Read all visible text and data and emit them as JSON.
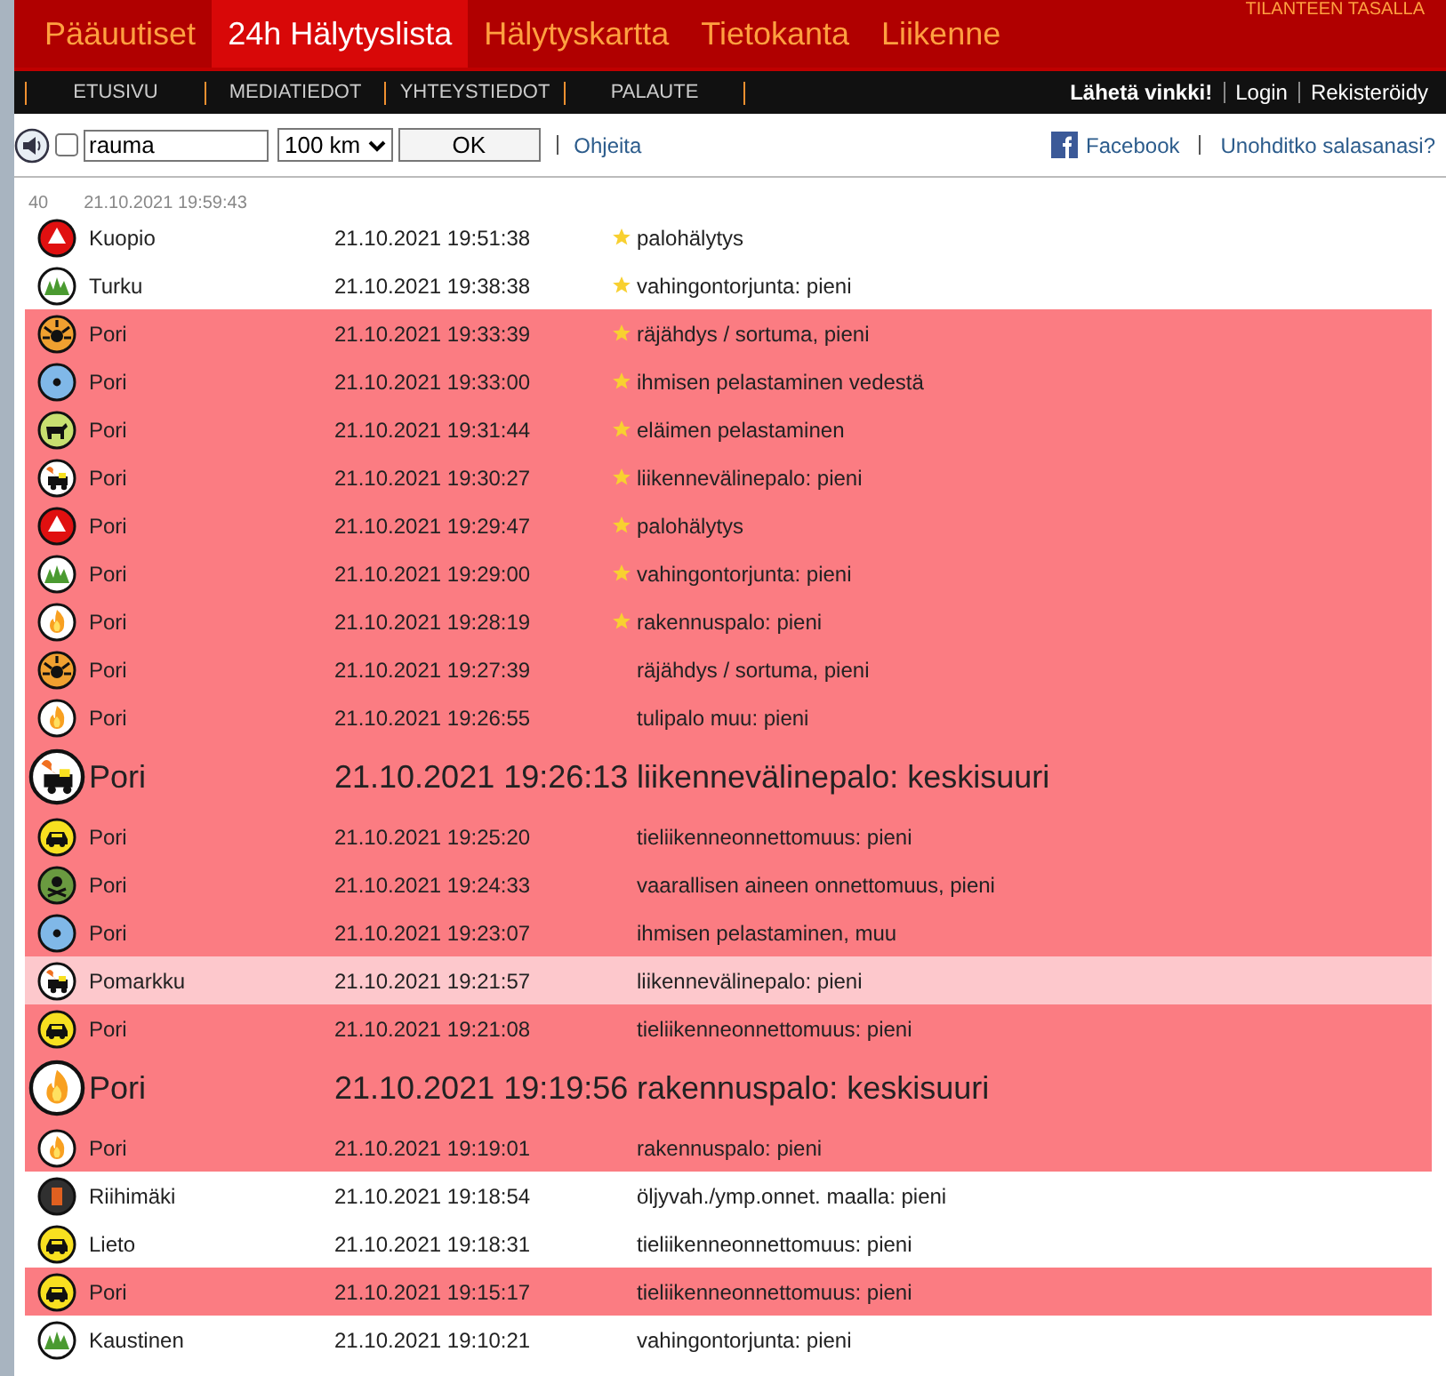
{
  "tagline": "TILANTEEN TASALLA",
  "main_nav": [
    {
      "label": "Pääuutiset",
      "selected": false
    },
    {
      "label": "24h Hälytyslista",
      "selected": true
    },
    {
      "label": "Hälytyskartta",
      "selected": false
    },
    {
      "label": "Tietokanta",
      "selected": false
    },
    {
      "label": "Liikenne",
      "selected": false
    }
  ],
  "sub_nav": [
    "ETUSIVU",
    "MEDIATIEDOT",
    "YHTEYSTIEDOT",
    "PALAUTE"
  ],
  "user_links": [
    {
      "label": "Lähetä vinkki!",
      "kind": "tip"
    },
    {
      "label": "Login",
      "kind": "link"
    },
    {
      "label": "Rekisteröidy",
      "kind": "link"
    }
  ],
  "toolbar": {
    "sound_checked": false,
    "search": {
      "value": "rauma"
    },
    "radius": "100 km",
    "ok": "OK",
    "help": "Ohjeita",
    "facebook": "Facebook",
    "forgot": "Unohditko salasanasi?"
  },
  "list": {
    "count": "40",
    "updated": "21.10.2021 19:59:43",
    "rows": [
      {
        "kind": "alarm",
        "place": "Kuopio",
        "time": "21.10.2021 19:51:38",
        "starred": true,
        "type": "palohälytys",
        "highlighted": false,
        "faded": false,
        "large": false
      },
      {
        "kind": "forest",
        "place": "Turku",
        "time": "21.10.2021 19:38:38",
        "starred": true,
        "type": "vahingontorjunta: pieni",
        "highlighted": false,
        "faded": false,
        "large": false
      },
      {
        "kind": "explosion",
        "place": "Pori",
        "time": "21.10.2021 19:33:39",
        "starred": true,
        "type": "räjähdys / sortuma, pieni",
        "highlighted": true,
        "faded": false,
        "large": false
      },
      {
        "kind": "water",
        "place": "Pori",
        "time": "21.10.2021 19:33:00",
        "starred": true,
        "type": "ihmisen pelastaminen vedestä",
        "highlighted": true,
        "faded": false,
        "large": false
      },
      {
        "kind": "animal",
        "place": "Pori",
        "time": "21.10.2021 19:31:44",
        "starred": true,
        "type": "eläimen pelastaminen",
        "highlighted": true,
        "faded": false,
        "large": false
      },
      {
        "kind": "vehicle_fire",
        "place": "Pori",
        "time": "21.10.2021 19:30:27",
        "starred": true,
        "type": "liikennevälinepalo: pieni",
        "highlighted": true,
        "faded": false,
        "large": false
      },
      {
        "kind": "alarm",
        "place": "Pori",
        "time": "21.10.2021 19:29:47",
        "starred": true,
        "type": "palohälytys",
        "highlighted": true,
        "faded": false,
        "large": false
      },
      {
        "kind": "forest",
        "place": "Pori",
        "time": "21.10.2021 19:29:00",
        "starred": true,
        "type": "vahingontorjunta: pieni",
        "highlighted": true,
        "faded": false,
        "large": false
      },
      {
        "kind": "fire",
        "place": "Pori",
        "time": "21.10.2021 19:28:19",
        "starred": true,
        "type": "rakennuspalo: pieni",
        "highlighted": true,
        "faded": false,
        "large": false
      },
      {
        "kind": "explosion",
        "place": "Pori",
        "time": "21.10.2021 19:27:39",
        "starred": false,
        "type": "räjähdys / sortuma, pieni",
        "highlighted": true,
        "faded": false,
        "large": false
      },
      {
        "kind": "fire",
        "place": "Pori",
        "time": "21.10.2021 19:26:55",
        "starred": false,
        "type": "tulipalo muu: pieni",
        "highlighted": true,
        "faded": false,
        "large": false
      },
      {
        "kind": "vehicle_fire",
        "place": "Pori",
        "time": "21.10.2021 19:26:13",
        "starred": false,
        "type": "liikennevälinepalo: keskisuuri",
        "highlighted": true,
        "faded": false,
        "large": true
      },
      {
        "kind": "traffic",
        "place": "Pori",
        "time": "21.10.2021 19:25:20",
        "starred": false,
        "type": "tieliikenneonnettomuus: pieni",
        "highlighted": true,
        "faded": false,
        "large": false
      },
      {
        "kind": "hazmat",
        "place": "Pori",
        "time": "21.10.2021 19:24:33",
        "starred": false,
        "type": "vaarallisen aineen onnettomuus, pieni",
        "highlighted": true,
        "faded": false,
        "large": false
      },
      {
        "kind": "water",
        "place": "Pori",
        "time": "21.10.2021 19:23:07",
        "starred": false,
        "type": "ihmisen pelastaminen, muu",
        "highlighted": true,
        "faded": false,
        "large": false
      },
      {
        "kind": "vehicle_fire",
        "place": "Pomarkku",
        "time": "21.10.2021 19:21:57",
        "starred": false,
        "type": "liikennevälinepalo: pieni",
        "highlighted": false,
        "faded": true,
        "large": false
      },
      {
        "kind": "traffic",
        "place": "Pori",
        "time": "21.10.2021 19:21:08",
        "starred": false,
        "type": "tieliikenneonnettomuus: pieni",
        "highlighted": true,
        "faded": false,
        "large": false
      },
      {
        "kind": "fire",
        "place": "Pori",
        "time": "21.10.2021 19:19:56",
        "starred": false,
        "type": "rakennuspalo: keskisuuri",
        "highlighted": true,
        "faded": false,
        "large": true
      },
      {
        "kind": "fire",
        "place": "Pori",
        "time": "21.10.2021 19:19:01",
        "starred": false,
        "type": "rakennuspalo: pieni",
        "highlighted": true,
        "faded": false,
        "large": false
      },
      {
        "kind": "oil",
        "place": "Riihimäki",
        "time": "21.10.2021 19:18:54",
        "starred": false,
        "type": "öljyvah./ymp.onnet. maalla: pieni",
        "highlighted": false,
        "faded": false,
        "large": false
      },
      {
        "kind": "traffic",
        "place": "Lieto",
        "time": "21.10.2021 19:18:31",
        "starred": false,
        "type": "tieliikenneonnettomuus: pieni",
        "highlighted": false,
        "faded": false,
        "large": false
      },
      {
        "kind": "traffic",
        "place": "Pori",
        "time": "21.10.2021 19:15:17",
        "starred": false,
        "type": "tieliikenneonnettomuus: pieni",
        "highlighted": true,
        "faded": false,
        "large": false
      },
      {
        "kind": "forest",
        "place": "Kaustinen",
        "time": "21.10.2021 19:10:21",
        "starred": false,
        "type": "vahingontorjunta: pieni",
        "highlighted": false,
        "faded": false,
        "large": false
      }
    ]
  }
}
